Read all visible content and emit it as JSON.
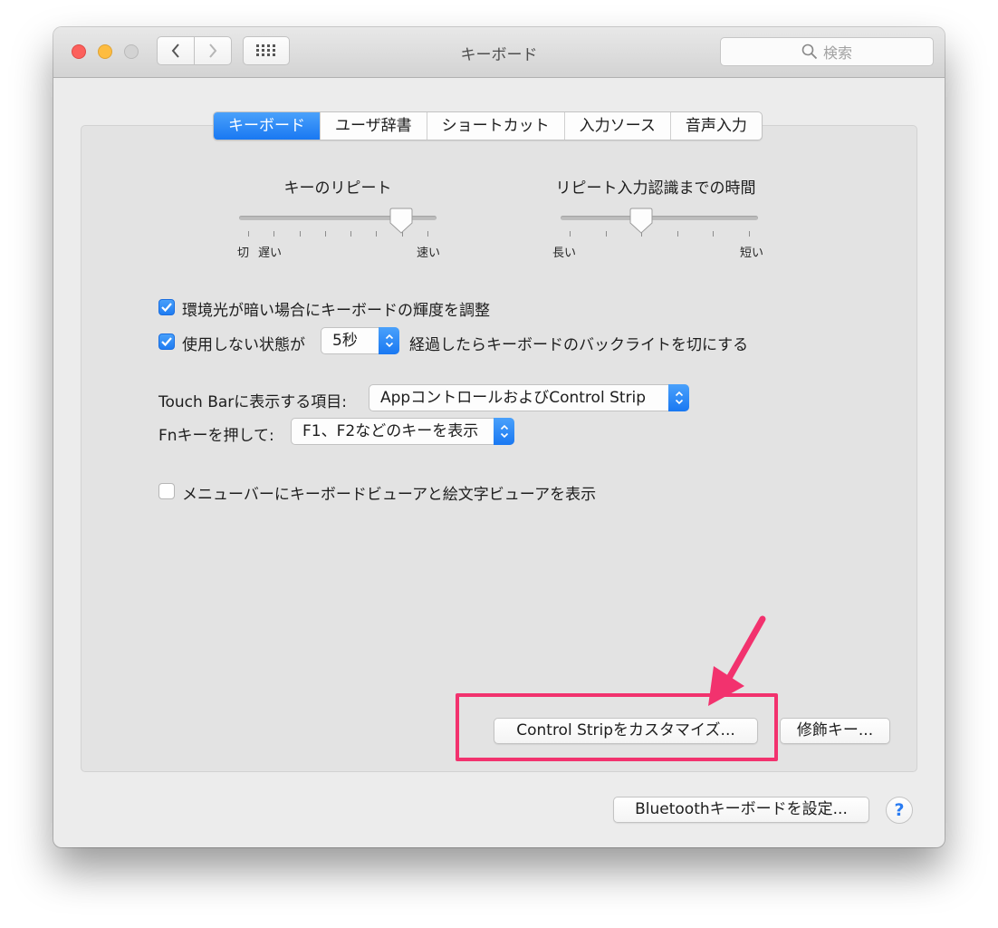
{
  "window": {
    "title": "キーボード",
    "search_placeholder": "検索"
  },
  "tabs": [
    {
      "label": "キーボード",
      "active": true
    },
    {
      "label": "ユーザ辞書",
      "active": false
    },
    {
      "label": "ショートカット",
      "active": false
    },
    {
      "label": "入力ソース",
      "active": false
    },
    {
      "label": "音声入力",
      "active": false
    }
  ],
  "key_repeat": {
    "title": "キーのリピート",
    "label_off": "切",
    "label_slow": "遅い",
    "label_fast": "速い",
    "level": 0.82
  },
  "repeat_delay": {
    "title": "リピート入力認識までの時間",
    "label_long": "長い",
    "label_short": "短い",
    "level": 0.41
  },
  "options": {
    "adjust_brightness_label": "環境光が暗い場合にキーボードの輝度を調整",
    "adjust_brightness_checked": true,
    "backlight_prefix": "使用しない状態が",
    "backlight_value": "5秒",
    "backlight_suffix": "経過したらキーボードのバックライトを切にする",
    "backlight_checked": true
  },
  "touchbar": {
    "label": "Touch Barに表示する項目:",
    "value": "AppコントロールおよびControl Strip"
  },
  "fn_key": {
    "label": "Fnキーを押して:",
    "value": "F1、F2などのキーを表示"
  },
  "viewer": {
    "label": "メニューバーにキーボードビューアと絵文字ビューアを表示",
    "checked": false
  },
  "buttons": {
    "control_strip": "Control Stripをカスタマイズ...",
    "modifier_keys": "修飾キー...",
    "bluetooth": "Bluetoothキーボードを設定...",
    "help": "?"
  },
  "colors": {
    "accent": "#1978f2",
    "annotation": "#f2326e"
  }
}
